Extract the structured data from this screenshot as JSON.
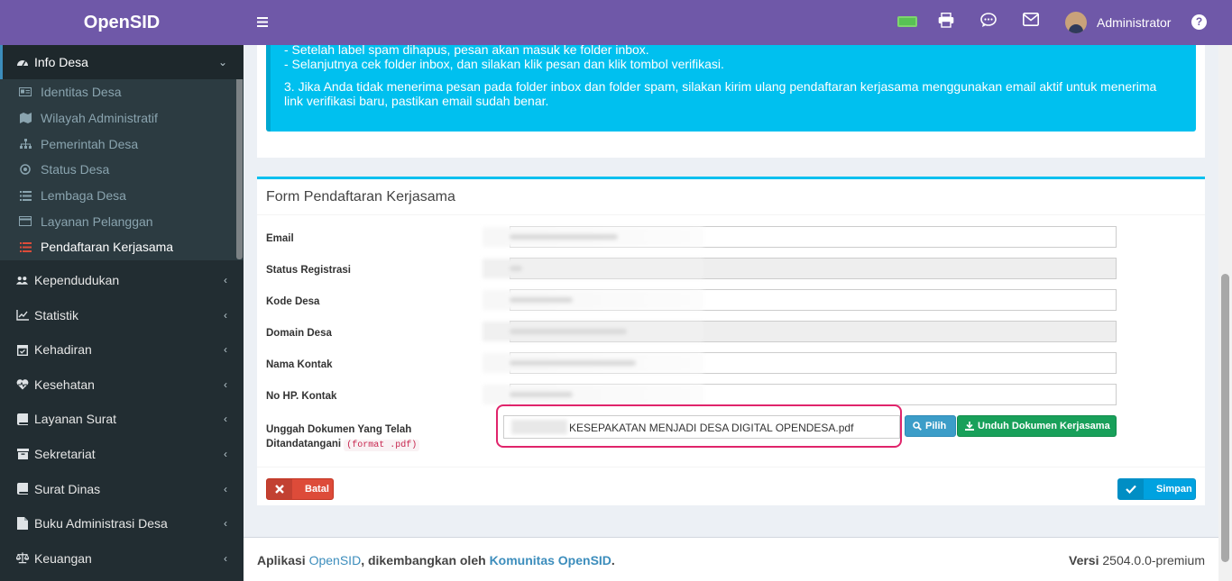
{
  "brand": "OpenSID",
  "topbar": {
    "username": "Administrator",
    "help_label": "?",
    "icons": [
      "battery-icon",
      "printer-icon",
      "chat-icon",
      "mail-icon",
      "avatar",
      "help-icon"
    ]
  },
  "sidebar": {
    "active": {
      "label": "Info Desa",
      "icon": "dashboard-icon"
    },
    "submenu": [
      {
        "label": "Identitas Desa",
        "icon": "id-card-icon"
      },
      {
        "label": "Wilayah Administratif",
        "icon": "map-icon"
      },
      {
        "label": "Pemerintah Desa",
        "icon": "sitemap-icon"
      },
      {
        "label": "Status Desa",
        "icon": "dot-circle-icon"
      },
      {
        "label": "Lembaga Desa",
        "icon": "list-icon"
      },
      {
        "label": "Layanan Pelanggan",
        "icon": "card-icon"
      },
      {
        "label": "Pendaftaran Kerjasama",
        "icon": "list-icon"
      }
    ],
    "items": [
      {
        "label": "Kependudukan",
        "icon": "users-icon"
      },
      {
        "label": "Statistik",
        "icon": "chart-line-icon"
      },
      {
        "label": "Kehadiran",
        "icon": "calendar-check-icon"
      },
      {
        "label": "Kesehatan",
        "icon": "heartbeat-icon"
      },
      {
        "label": "Layanan Surat",
        "icon": "book-icon"
      },
      {
        "label": "Sekretariat",
        "icon": "archive-icon"
      },
      {
        "label": "Surat Dinas",
        "icon": "book-icon"
      },
      {
        "label": "Buku Administrasi Desa",
        "icon": "file-icon"
      },
      {
        "label": "Keuangan",
        "icon": "balance-scale-icon"
      }
    ]
  },
  "callout": {
    "line1": "- Setelah label spam dihapus, pesan akan masuk ke folder inbox.",
    "line2": "- Selanjutnya cek folder inbox, dan silakan klik pesan dan klik tombol verifikasi.",
    "line3": "3. Jika Anda tidak menerima pesan pada folder inbox dan folder spam, silakan kirim ulang pendaftaran kerjasama menggunakan email aktif untuk menerima",
    "line4": "link verifikasi baru, pastikan email sudah benar."
  },
  "form": {
    "title": "Form Pendaftaran Kerjasama",
    "fields": [
      {
        "label": "Email",
        "readonly": false
      },
      {
        "label": "Status Registrasi",
        "readonly": true
      },
      {
        "label": "Kode Desa",
        "readonly": false
      },
      {
        "label": "Domain Desa",
        "readonly": true
      },
      {
        "label": "Nama Kontak",
        "readonly": false
      },
      {
        "label": "No HP. Kontak",
        "readonly": false
      }
    ],
    "upload_label_1": "Unggah Dokumen Yang Telah",
    "upload_label_2": "Ditandatangani",
    "upload_format": "(format .pdf)",
    "upload_filename": "KESEPAKATAN MENJADI DESA DIGITAL OPENDESA.pdf",
    "pilih_label": "Pilih",
    "unduh_label": "Unduh Dokumen Kerjasama",
    "batal_label": "Batal",
    "simpan_label": "Simpan"
  },
  "footer": {
    "text_1": "Aplikasi ",
    "link_1": "OpenSID",
    "text_2": ", dikembangkan oleh ",
    "link_2": "Komunitas OpenSID",
    "text_3": ".",
    "version_label": "Versi",
    "version_value": "2504.0.0-premium"
  }
}
